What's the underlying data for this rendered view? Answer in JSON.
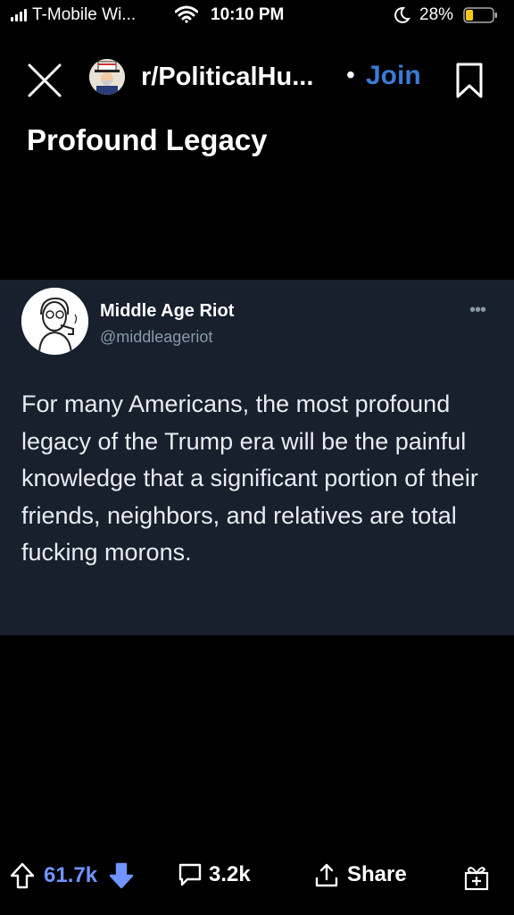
{
  "status_bar": {
    "carrier": "T-Mobile Wi...",
    "time": "10:10 PM",
    "battery_percent": "28%",
    "battery_level": 0.28,
    "icons": [
      "signal-icon",
      "wifi-icon",
      "moon-icon",
      "battery-icon"
    ]
  },
  "header": {
    "subreddit": "r/PoliticalHu...",
    "separator": "•",
    "join_label": "Join",
    "icons": [
      "close-icon",
      "subreddit-avatar",
      "bookmark-icon"
    ]
  },
  "post": {
    "title": "Profound Legacy"
  },
  "tweet": {
    "name": "Middle Age Riot",
    "handle": "@middleageriot",
    "more": "•••",
    "text": "For many Americans, the most profound legacy of the Trump era will be the painful knowledge that a significant portion of their friends, neighbors, and relatives are total fucking morons."
  },
  "actions": {
    "upvotes": "61.7k",
    "comments": "3.2k",
    "share_label": "Share",
    "icons": [
      "upvote-icon",
      "downvote-icon",
      "comment-icon",
      "share-icon",
      "award-icon"
    ]
  },
  "colors": {
    "background": "#000000",
    "tweet_card": "#18202e",
    "accent_blue": "#3a7bd5",
    "upvote_blue": "#7193ff",
    "handle_gray": "#8899a6"
  }
}
